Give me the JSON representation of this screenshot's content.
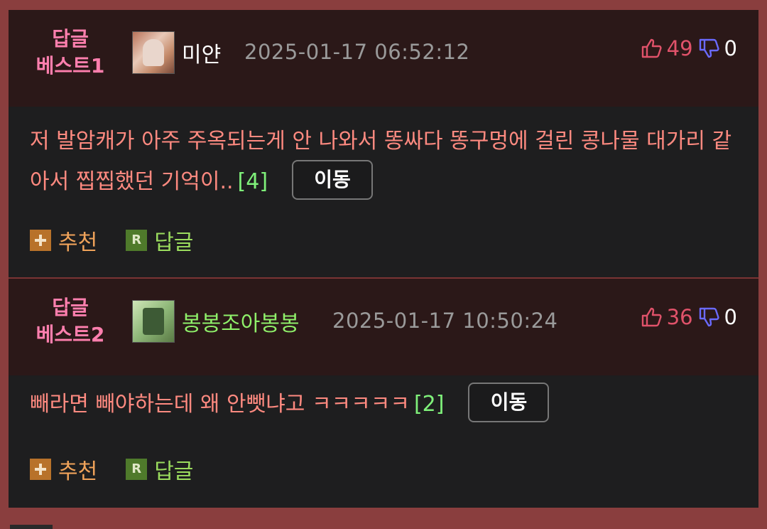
{
  "replies": [
    {
      "badge_line1": "답글",
      "badge_line2": "베스트1",
      "nickname": "미얀",
      "date": "2025-01-17 06:52:12",
      "upvotes": "49",
      "downvotes": "0",
      "text": "저 발암캐가 아주 주옥되는게 안 나와서 똥싸다 똥구멍에 걸린 콩나물 대가리 같아서 찝찝했던 기억이..",
      "reply_count": "[4]",
      "move_label": "이동",
      "recommend_label": "추천",
      "reply_label": "답글",
      "reply_icon_letter": "R"
    },
    {
      "badge_line1": "답글",
      "badge_line2": "베스트2",
      "nickname": "봉봉조아봉봉",
      "date": "2025-01-17 10:50:24",
      "upvotes": "36",
      "downvotes": "0",
      "text": "빼라면 빼야하는데 왜 안뺏냐고 ㅋㅋㅋㅋㅋ",
      "reply_count": "[2]",
      "move_label": "이동",
      "recommend_label": "추천",
      "reply_label": "답글",
      "reply_icon_letter": "R"
    }
  ],
  "colors": {
    "background": "#231b1c",
    "border": "#8a3e3e",
    "badge": "#ff7fae",
    "comment_text": "#ff8a80",
    "reply_count": "#7ff07a",
    "upvote": "#e0526a",
    "downvote_icon": "#6a6aff"
  },
  "icons": {
    "upvote": "thumbs-up-icon",
    "downvote": "thumbs-down-icon",
    "recommend": "plus-icon",
    "reply": "reply-r-icon"
  }
}
